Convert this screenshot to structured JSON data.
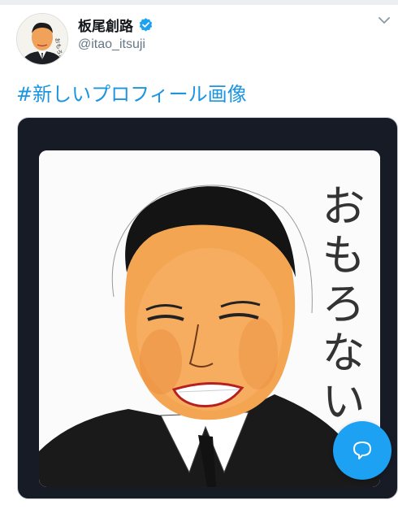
{
  "tweet": {
    "display_name": "板尾創路",
    "handle": "@itao_itsuji",
    "text": "#新しいプロフィール画像",
    "verified": true
  },
  "avatar": {
    "caption": "おもろない"
  },
  "media": {
    "handwriting": "おもろない"
  },
  "icons": {
    "verified": "verified-badge-icon",
    "chevron": "chevron-down-icon",
    "compose": "speech-bubble-icon"
  },
  "colors": {
    "accent": "#1da1f2",
    "link": "#1b95e0",
    "handle": "#657786",
    "media_frame": "#161b26"
  }
}
